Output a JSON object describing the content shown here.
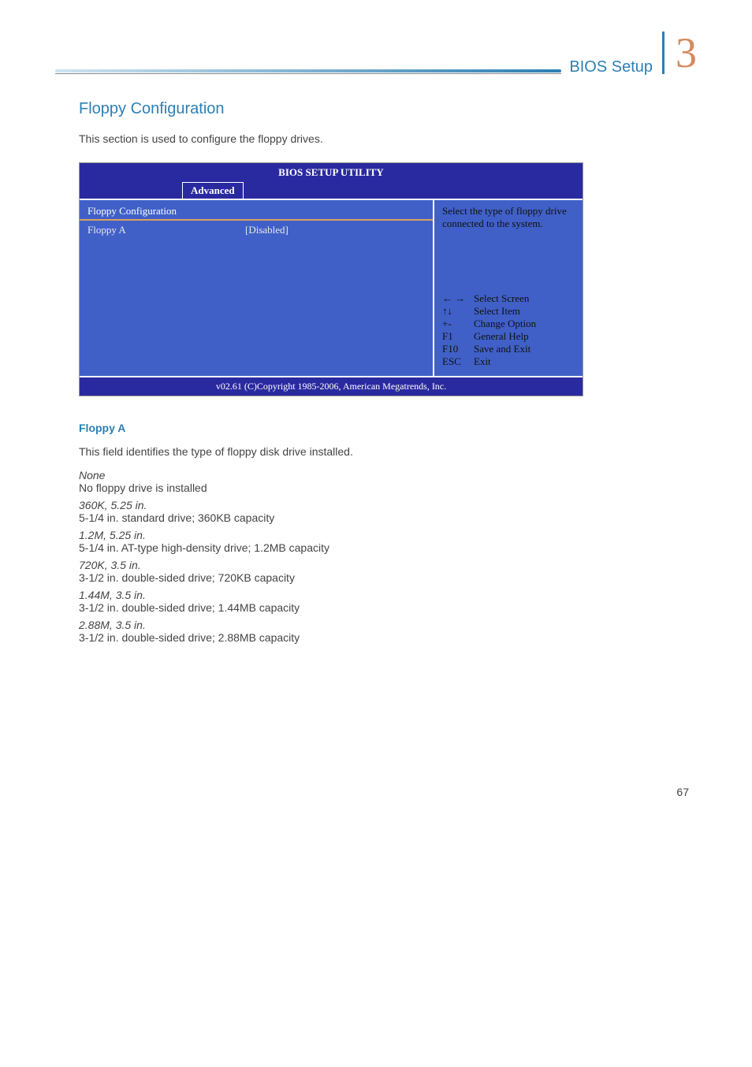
{
  "header": {
    "title": "BIOS Setup",
    "chapter": "3"
  },
  "section_heading": "Floppy Configuration",
  "intro": "This section is used to configure the floppy drives.",
  "bios": {
    "title": "BIOS SETUP UTILITY",
    "tab": "Advanced",
    "section_label": "Floppy Configuration",
    "setting_label": "Floppy A",
    "setting_value": "[Disabled]",
    "help_text": "Select the type of floppy drive connected to the system.",
    "keys": [
      {
        "sym": "← →",
        "desc": "Select Screen"
      },
      {
        "sym": "↑↓",
        "desc": "Select Item"
      },
      {
        "sym": "+-",
        "desc": "Change Option"
      },
      {
        "sym": "F1",
        "desc": "General Help"
      },
      {
        "sym": "F10",
        "desc": "Save and Exit"
      },
      {
        "sym": "ESC",
        "desc": "Exit"
      }
    ],
    "footer": "v02.61 (C)Copyright 1985-2006, American Megatrends, Inc."
  },
  "floppy_a": {
    "heading": "Floppy A",
    "intro": "This field identifies the type of floppy disk drive installed.",
    "options": [
      {
        "name": "None",
        "desc": "No floppy drive is installed"
      },
      {
        "name": "360K, 5.25 in.",
        "desc": "5-1/4 in. standard drive; 360KB capacity"
      },
      {
        "name": "1.2M, 5.25 in.",
        "desc": "5-1/4 in. AT-type high-density drive; 1.2MB capacity"
      },
      {
        "name": "720K, 3.5 in.",
        "desc": "3-1/2 in. double-sided drive; 720KB capacity"
      },
      {
        "name": "1.44M, 3.5 in.",
        "desc": "3-1/2 in. double-sided drive; 1.44MB capacity"
      },
      {
        "name": "2.88M, 3.5 in.",
        "desc": "3-1/2 in. double-sided drive; 2.88MB capacity"
      }
    ]
  },
  "page_number": "67"
}
